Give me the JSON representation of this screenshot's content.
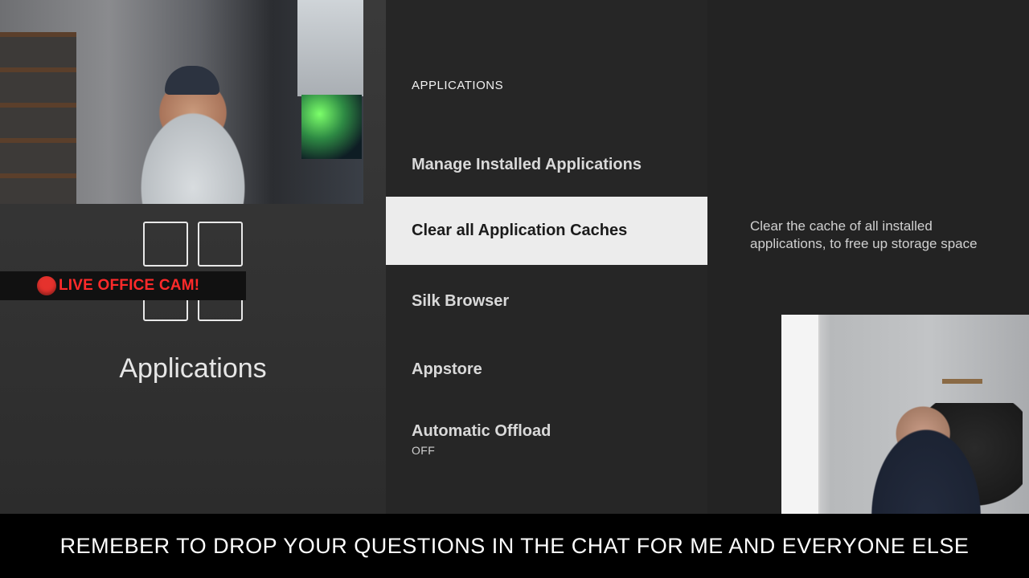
{
  "overlay": {
    "live_label": "LIVE OFFICE CAM!",
    "caption": "REMEBER TO DROP YOUR QUESTIONS IN THE CHAT FOR ME AND EVERYONE ELSE"
  },
  "left": {
    "app_name": "Applications",
    "icon": "apps-grid-icon"
  },
  "menu": {
    "section_title": "APPLICATIONS",
    "items": [
      {
        "label": "Manage Installed Applications",
        "sub": ""
      },
      {
        "label": "Clear all Application Caches",
        "sub": ""
      },
      {
        "label": "Silk Browser",
        "sub": ""
      },
      {
        "label": "Appstore",
        "sub": ""
      },
      {
        "label": "Automatic Offload",
        "sub": "OFF"
      }
    ],
    "selected_index": 1
  },
  "description": "Clear the cache of all installed applications, to free up storage space",
  "colors": {
    "selected_bg": "#ececec",
    "live_red": "#ff2a2a"
  }
}
